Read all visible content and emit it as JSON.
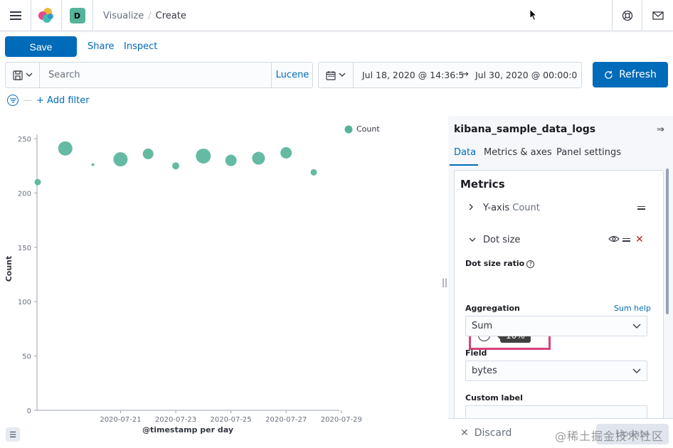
{
  "topnav": {
    "space_initial": "D",
    "breadcrumbs": [
      "Visualize",
      "Create"
    ]
  },
  "toolbar": {
    "save_label": "Save",
    "share_label": "Share",
    "inspect_label": "Inspect"
  },
  "query": {
    "placeholder": "Search",
    "language": "Lucene"
  },
  "time": {
    "start": "Jul 18, 2020 @ 14:36:5",
    "end": "Jul 30, 2020 @ 00:00:0",
    "refresh_label": "Refresh"
  },
  "filters": {
    "add_label": "+ Add filter"
  },
  "chart_data": {
    "type": "scatter",
    "xlabel": "@timestamp per day",
    "ylabel": "Count",
    "ylim": [
      0,
      250
    ],
    "yticks": [
      "0",
      "50",
      "100",
      "150",
      "200",
      "250"
    ],
    "xticks": [
      "2020-07-21",
      "2020-07-23",
      "2020-07-25",
      "2020-07-27",
      "2020-07-29"
    ],
    "legend": "Count",
    "legend_position": "top-right",
    "color": "#54b399",
    "series": [
      {
        "name": "Count",
        "x": [
          "2020-07-18",
          "2020-07-19",
          "2020-07-20",
          "2020-07-21",
          "2020-07-22",
          "2020-07-23",
          "2020-07-24",
          "2020-07-25",
          "2020-07-26",
          "2020-07-27",
          "2020-07-28",
          "2020-07-29"
        ],
        "values": [
          210,
          241,
          226,
          231,
          236,
          225,
          234,
          230,
          232,
          237,
          219,
          0
        ],
        "dot_size_rel": [
          0.45,
          1.0,
          0.2,
          1.0,
          0.75,
          0.5,
          1.05,
          0.8,
          0.9,
          0.8,
          0.45,
          0
        ]
      }
    ]
  },
  "sidebar": {
    "index": "kibana_sample_data_logs",
    "tabs": [
      "Data",
      "Metrics & axes",
      "Panel settings"
    ],
    "metrics_title": "Metrics",
    "yaxis": {
      "label": "Y-axis",
      "sub": "Count"
    },
    "dotsize": {
      "label": "Dot size"
    },
    "dot_size_ratio_label": "Dot size ratio",
    "dot_size_ratio_value": 10,
    "dot_size_ratio_text": "10%",
    "aggregation_label": "Aggregation",
    "sum_help": "Sum help",
    "aggregation_value": "Sum",
    "field_label": "Field",
    "field_value": "bytes",
    "custom_label": "Custom label"
  },
  "bottom": {
    "discard_label": "Discard",
    "update_label": "Update"
  },
  "watermark": "@稀土掘金技术社区",
  "colors": {
    "primary": "#006bb8",
    "dot": "#54b399",
    "highlight": "#d6437b",
    "danger": "#bd271e"
  }
}
